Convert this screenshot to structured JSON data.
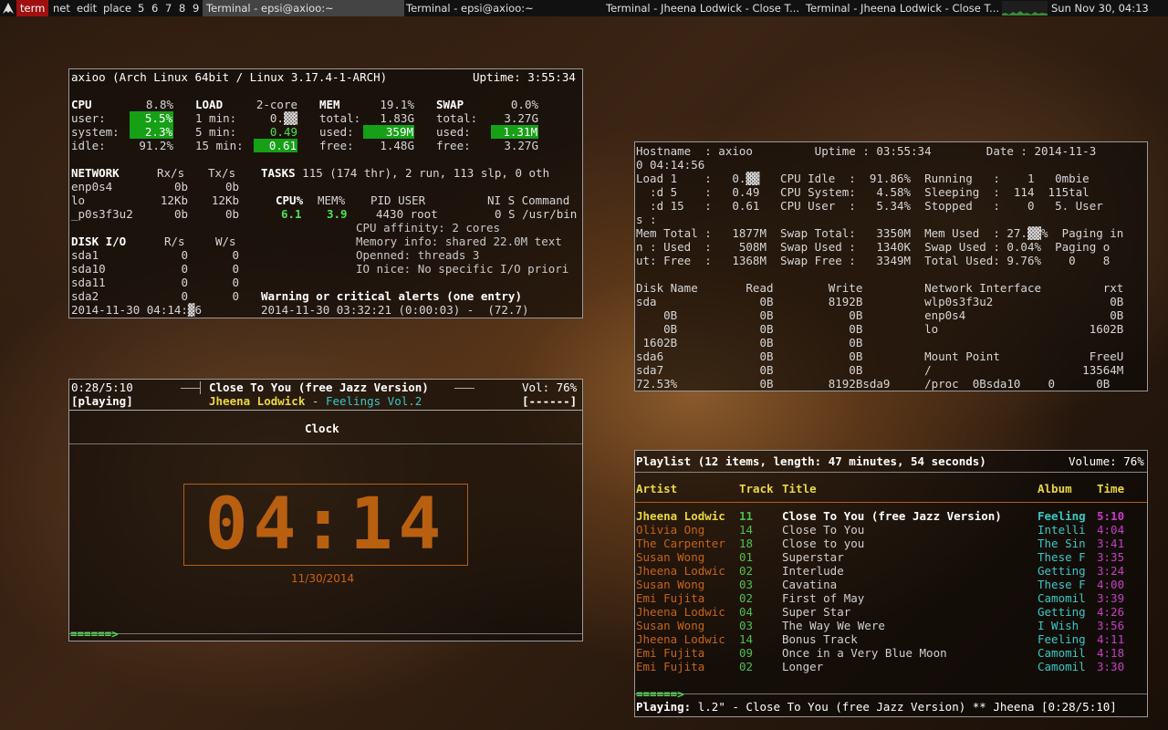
{
  "topbar": {
    "tag_label": "term",
    "workspaces": [
      "net",
      "edit",
      "place",
      "5",
      "6",
      "7",
      "8",
      "9"
    ],
    "tabs": [
      "Terminal - epsi@axioo:~",
      "Terminal - epsi@axioo:~",
      "Terminal - Jheena Lodwick - Close T...",
      "Terminal - Jheena Lodwick - Close T..."
    ],
    "clock": "Sun Nov 30, 04:13"
  },
  "glances": {
    "hostline": "axioo (Arch Linux 64bit / Linux 3.17.4-1-ARCH)",
    "uptime": "Uptime: 3:55:34",
    "cpu": {
      "label": "CPU",
      "total": "8.8%",
      "rows": [
        [
          "user:",
          "5.5%"
        ],
        [
          "system:",
          "2.3%"
        ],
        [
          "idle:",
          "91.2%"
        ]
      ]
    },
    "load": {
      "label": "LOAD",
      "cores": "2-core",
      "rows": [
        [
          "1 min:",
          "0.▓▓"
        ],
        [
          "5 min:",
          "0.49"
        ],
        [
          "15 min:",
          "0.61"
        ]
      ]
    },
    "mem": {
      "label": "MEM",
      "total": "19.1%",
      "rows": [
        [
          "total:",
          "1.83G"
        ],
        [
          "used:",
          "359M"
        ],
        [
          "free:",
          "1.48G"
        ]
      ]
    },
    "swap": {
      "label": "SWAP",
      "total": "0.0%",
      "rows": [
        [
          "total:",
          "3.27G"
        ],
        [
          "used:",
          "1.31M"
        ],
        [
          "free:",
          "3.27G"
        ]
      ]
    },
    "network": {
      "header": [
        "NETWORK",
        "Rx/s",
        "Tx/s"
      ],
      "rows": [
        [
          "enp0s4",
          "0b",
          "0b"
        ],
        [
          "lo",
          "12Kb",
          "12Kb"
        ],
        [
          "_p0s3f3u2",
          "0b",
          "0b"
        ]
      ]
    },
    "tasks": "TASKS 115 (174 thr), 2 run, 113 slp, 0 oth",
    "proc_header": [
      "CPU%",
      "MEM%",
      "PID USER",
      "NI S Command"
    ],
    "proc_row": [
      "6.1",
      "3.9",
      "4430 root",
      "0 S /usr/bin"
    ],
    "proc_details": [
      "CPU affinity: 2 cores",
      "Memory info: shared 22.0M text",
      "Openned: threads 3",
      "IO nice: No specific I/O priori"
    ],
    "disk": {
      "header": [
        "DISK I/O",
        "R/s",
        "W/s"
      ],
      "rows": [
        [
          "sda1",
          "0",
          "0"
        ],
        [
          "sda10",
          "0",
          "0"
        ],
        [
          "sda11",
          "0",
          "0"
        ],
        [
          "sda2",
          "0",
          "0"
        ]
      ]
    },
    "alerts_title": "Warning or critical alerts (one entry)",
    "alert_row": "2014-11-30 03:32:21 (0:00:03) -  (72.7)",
    "timestamp": "2014-11-30 04:14:▓6"
  },
  "sysinfo": {
    "lines": [
      "Hostname  : axioo         Uptime : 03:55:34        Date : 2014-11-3",
      "0 04:14:56",
      "Load 1    :   0.▓▓   CPU Idle  :  91.86%  Running   :    1   0mbie",
      "  :d 5    :   0.49   CPU System:   4.58%  Sleeping  :  114  115tal",
      "  :d 15   :   0.61   CPU User  :   5.34%  Stopped   :    0   5. User",
      "s :",
      "Mem Total :   1877M  Swap Total:   3350M  Mem Used  : 27.▓▓%  Paging in",
      "n : Used  :    508M  Swap Used :   1340K  Swap Used : 0.04%  Paging o",
      "ut: Free  :   1368M  Swap Free :   3349M  Total Used: 9.76%    0    8",
      "",
      "Disk Name       Read        Write         Network Interface         rxt",
      "sda               0B        8192B         wlp0s3f3u2                 0B",
      "    0B            0B           0B         enp0s4                     0B",
      "    0B            0B           0B         lo                      1602B",
      " 1602B            0B           0B",
      "sda6              0B           0B         Mount Point             FreeU",
      "sda7              0B           0B         /                      13564M",
      "72.53%            0B        8192Bsda9     /proc  0Bsda10    0      0B"
    ]
  },
  "player": {
    "time": "0:28/5:10",
    "state": "[playing]",
    "title": "Close To You (free Jazz Version)",
    "artist": "Jheena Lodwick",
    "sep": " - ",
    "album": "Feelings Vol.2",
    "volume": "Vol: 76%",
    "progress_box": "[------]",
    "clock_title": "Clock",
    "clock_digits": "04:14",
    "clock_date": "11/30/2014",
    "progress_bar": "======>"
  },
  "playlist": {
    "header": "Playlist (12 items, length: 47 minutes, 54 seconds)",
    "volume": "Volume: 76%",
    "columns": [
      "Artist",
      "Track",
      "Title",
      "Album",
      "Time"
    ],
    "rows": [
      {
        "artist": "Jheena Lodwic",
        "track": "11",
        "title": "Close To You (free Jazz Version)",
        "album": "Feeling",
        "time": "5:10"
      },
      {
        "artist": "Olivia Ong",
        "track": "14",
        "title": "Close To You",
        "album": "Intelli",
        "time": "4:04"
      },
      {
        "artist": "The Carpenter",
        "track": "18",
        "title": "Close to you",
        "album": "The Sin",
        "time": "3:41"
      },
      {
        "artist": "Susan Wong",
        "track": "01",
        "title": "Superstar",
        "album": "These F",
        "time": "3:35"
      },
      {
        "artist": "Jheena Lodwic",
        "track": "02",
        "title": "Interlude",
        "album": "Getting",
        "time": "3:24"
      },
      {
        "artist": "Susan Wong",
        "track": "03",
        "title": "Cavatina",
        "album": "These F",
        "time": "4:00"
      },
      {
        "artist": "Emi Fujita",
        "track": "02",
        "title": "First of May",
        "album": "Camomil",
        "time": "3:39"
      },
      {
        "artist": "Jheena Lodwic",
        "track": "04",
        "title": "Super Star",
        "album": "Getting",
        "time": "4:26"
      },
      {
        "artist": "Susan Wong",
        "track": "03",
        "title": "The Way We Were",
        "album": "I Wish",
        "time": "3:56"
      },
      {
        "artist": "Jheena Lodwic",
        "track": "14",
        "title": "Bonus Track",
        "album": "Feeling",
        "time": "4:11"
      },
      {
        "artist": "Emi Fujita",
        "track": "09",
        "title": "Once in a Very Blue Moon",
        "album": "Camomil",
        "time": "4:18"
      },
      {
        "artist": "Emi Fujita",
        "track": "02",
        "title": "Longer",
        "album": "Camomil",
        "time": "3:30"
      }
    ],
    "progress_bar": "======>",
    "status_label": "Playing:",
    "status_text": " l.2\" - Close To You (free Jazz Version) ** Jheena [0:28/5:10]"
  }
}
